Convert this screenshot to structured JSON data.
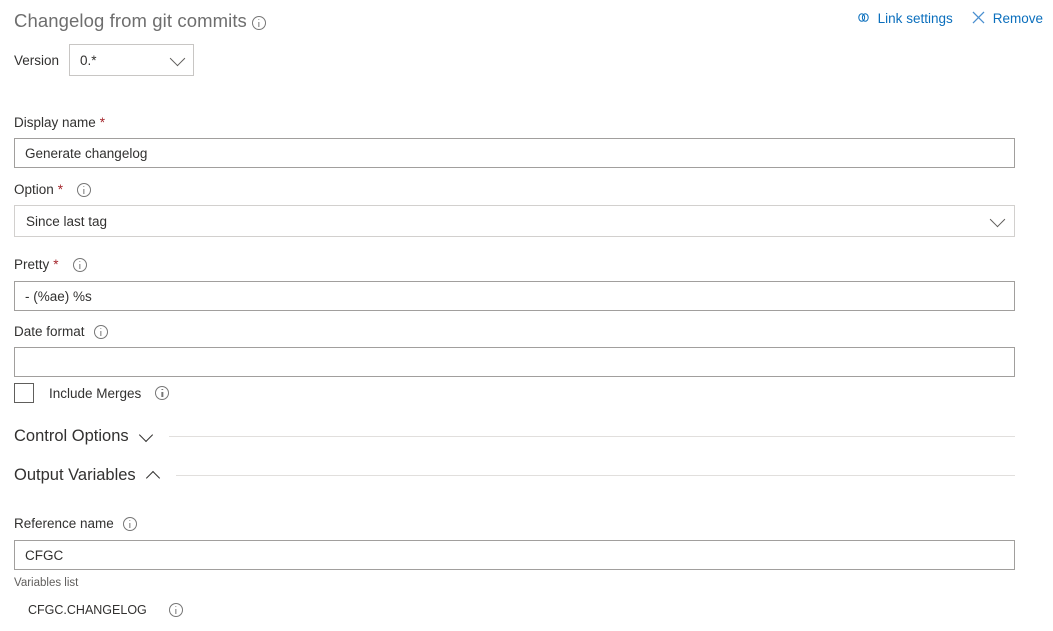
{
  "header": {
    "title": "Changelog from git commits",
    "title_info_icon": "info-icon",
    "actions": [
      {
        "label": "Link settings",
        "icon": "link-icon"
      },
      {
        "label": "Remove",
        "icon": "close-icon"
      }
    ],
    "link_color": "#0b6fbd"
  },
  "version": {
    "label": "Version",
    "value": "0.*",
    "chevron_icon": "chevron-down-icon"
  },
  "fields": {
    "display_name": {
      "label": "Display name",
      "required": true,
      "required_marker": "*",
      "value": "Generate changelog"
    },
    "option": {
      "label": "Option",
      "required": true,
      "required_marker": "*",
      "info_icon": "info-icon",
      "value": "Since last tag",
      "chevron_icon": "chevron-down-icon"
    },
    "pretty": {
      "label": "Pretty",
      "required": true,
      "required_marker": "*",
      "info_icon": "info-icon",
      "value": "- (%ae) %s"
    },
    "date_format": {
      "label": "Date format",
      "info_icon": "info-icon",
      "value": "",
      "placeholder": ""
    },
    "include_merges": {
      "label": "Include Merges",
      "checked": false,
      "info_icon": "info-icon"
    }
  },
  "sections": [
    {
      "title": "Control Options",
      "expanded": false,
      "chevron_icon": "chevron-down-icon"
    },
    {
      "title": "Output Variables",
      "expanded": true,
      "chevron_icon": "chevron-up-icon"
    }
  ],
  "output_variables": {
    "reference_name": {
      "label": "Reference name",
      "info_icon": "info-icon",
      "value": "CFGC"
    },
    "variables_list_label": "Variables list",
    "variables": [
      {
        "name": "CFGC.CHANGELOG",
        "info_icon": "info-icon"
      }
    ]
  },
  "colors": {
    "required_asterisk": "#a4262c",
    "link": "#0b6fbd",
    "title": "#6e6e6e",
    "text": "#323130",
    "border": "#a19f9d",
    "rule": "#e1dfdd"
  }
}
